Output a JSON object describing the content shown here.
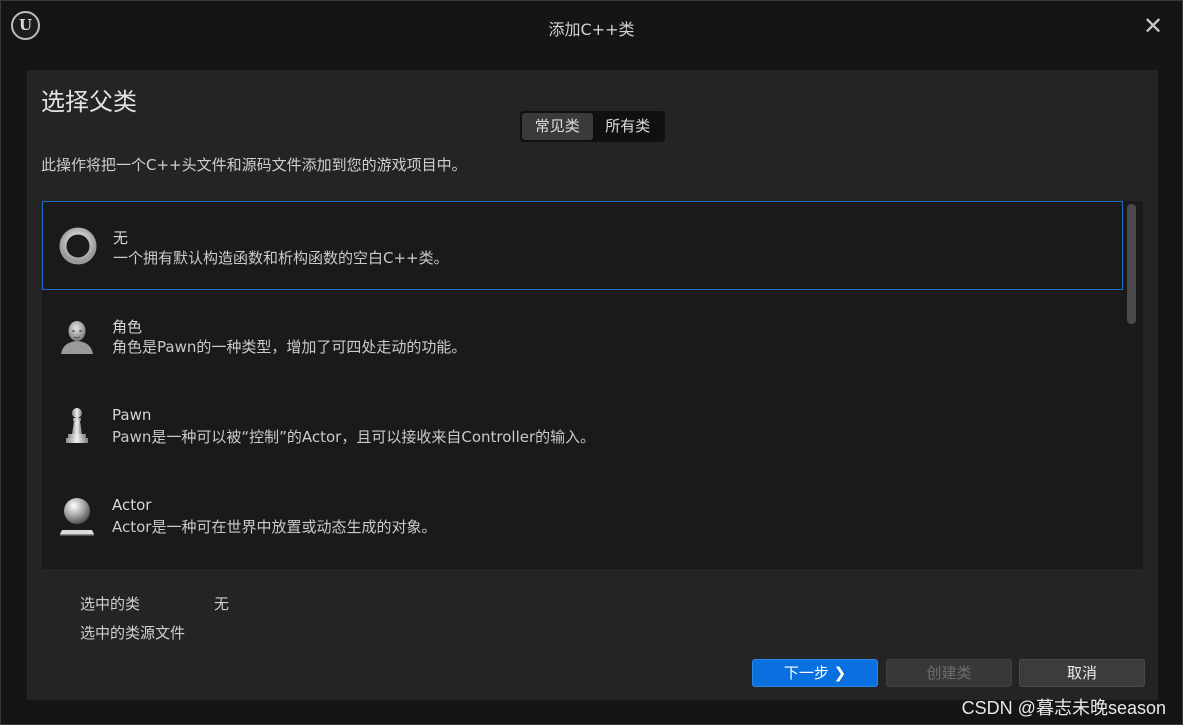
{
  "window": {
    "title": "添加C++类",
    "logo_text": "U"
  },
  "panel": {
    "heading": "选择父类",
    "tabs": [
      {
        "label": "常见类",
        "active": true
      },
      {
        "label": "所有类",
        "active": false
      }
    ],
    "description": "此操作将把一个C++头文件和源码文件添加到您的游戏项目中。"
  },
  "classes": [
    {
      "name": "无",
      "description": "一个拥有默认构造函数和析构函数的空白C++类。",
      "icon": "ring-icon",
      "selected": true
    },
    {
      "name": "角色",
      "description": "角色是Pawn的一种类型，增加了可四处走动的功能。",
      "icon": "character-bust-icon",
      "selected": false
    },
    {
      "name": "Pawn",
      "description": "Pawn是一种可以被“控制”的Actor，且可以接收来自Controller的输入。",
      "icon": "pawn-chess-icon",
      "selected": false
    },
    {
      "name": "Actor",
      "description": "Actor是一种可在世界中放置或动态生成的对象。",
      "icon": "sphere-on-base-icon",
      "selected": false
    }
  ],
  "info": {
    "selected_class_label": "选中的类",
    "selected_class_value": "无",
    "selected_source_label": "选中的类源文件"
  },
  "buttons": {
    "next": "下一步 ❯",
    "create": "创建类",
    "cancel": "取消"
  },
  "colors": {
    "accent": "#0a70e0",
    "selection_border": "#1f6fc9"
  },
  "watermark": "CSDN @暮志未晚season"
}
